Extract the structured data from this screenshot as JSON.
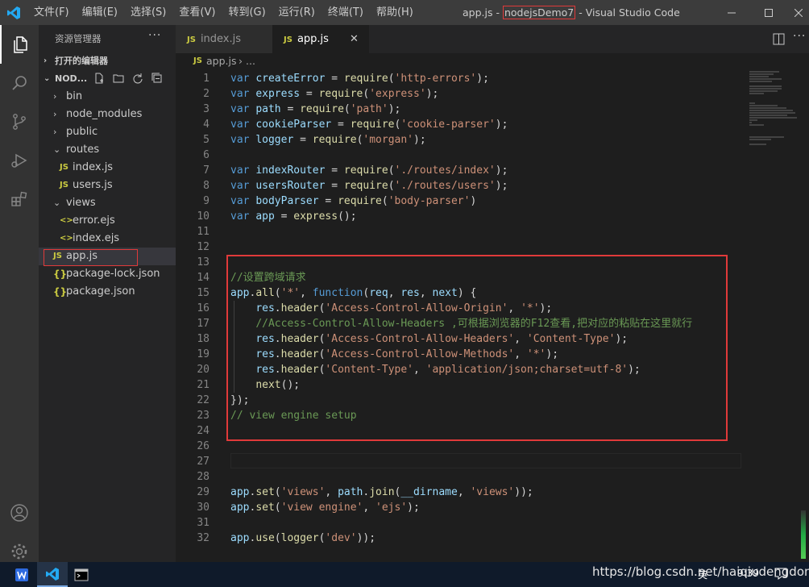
{
  "window": {
    "title_prefix": "app.js - ",
    "title_project": "nodejsDemo7",
    "title_suffix": " - Visual Studio Code"
  },
  "menu": [
    "文件(F)",
    "编辑(E)",
    "选择(S)",
    "查看(V)",
    "转到(G)",
    "运行(R)",
    "终端(T)",
    "帮助(H)"
  ],
  "sidebar": {
    "title": "资源管理器",
    "open_editors": "打开的编辑器",
    "project_label": "NOD...",
    "tree": [
      {
        "name": "bin",
        "type": "folder",
        "expanded": false,
        "depth": 0
      },
      {
        "name": "node_modules",
        "type": "folder",
        "expanded": false,
        "depth": 0
      },
      {
        "name": "public",
        "type": "folder",
        "expanded": false,
        "depth": 0
      },
      {
        "name": "routes",
        "type": "folder",
        "expanded": true,
        "depth": 0
      },
      {
        "name": "index.js",
        "type": "js",
        "depth": 1
      },
      {
        "name": "users.js",
        "type": "js",
        "depth": 1
      },
      {
        "name": "views",
        "type": "folder",
        "expanded": true,
        "depth": 0
      },
      {
        "name": "error.ejs",
        "type": "ejs",
        "depth": 1
      },
      {
        "name": "index.ejs",
        "type": "ejs",
        "depth": 1
      },
      {
        "name": "app.js",
        "type": "js",
        "depth": 0,
        "selected": true
      },
      {
        "name": "package-lock.json",
        "type": "json",
        "depth": 0
      },
      {
        "name": "package.json",
        "type": "json",
        "depth": 0
      }
    ]
  },
  "icons": {
    "js": "JS",
    "json": "{}",
    "ejs": "<>",
    "chevron_right": "›",
    "chevron_down": "⌄",
    "more": "···",
    "close": "✕"
  },
  "tabs": [
    {
      "label": "index.js",
      "active": false
    },
    {
      "label": "app.js",
      "active": true
    }
  ],
  "breadcrumb": {
    "file": "app.js",
    "rest": "..."
  },
  "code": [
    {
      "n": "1",
      "t": [
        [
          "k",
          "var "
        ],
        [
          "v",
          "createError"
        ],
        [
          "p",
          " = "
        ],
        [
          "f",
          "require"
        ],
        [
          "p",
          "("
        ],
        [
          "s",
          "'http-errors'"
        ],
        [
          "p",
          ");"
        ]
      ]
    },
    {
      "n": "2",
      "t": [
        [
          "k",
          "var "
        ],
        [
          "v",
          "express"
        ],
        [
          "p",
          " = "
        ],
        [
          "f",
          "require"
        ],
        [
          "p",
          "("
        ],
        [
          "s",
          "'express'"
        ],
        [
          "p",
          ");"
        ]
      ]
    },
    {
      "n": "3",
      "t": [
        [
          "k",
          "var "
        ],
        [
          "v",
          "path"
        ],
        [
          "p",
          " = "
        ],
        [
          "f",
          "require"
        ],
        [
          "p",
          "("
        ],
        [
          "s",
          "'path'"
        ],
        [
          "p",
          ");"
        ]
      ]
    },
    {
      "n": "4",
      "t": [
        [
          "k",
          "var "
        ],
        [
          "v",
          "cookieParser"
        ],
        [
          "p",
          " = "
        ],
        [
          "f",
          "require"
        ],
        [
          "p",
          "("
        ],
        [
          "s",
          "'cookie-parser'"
        ],
        [
          "p",
          ");"
        ]
      ]
    },
    {
      "n": "5",
      "t": [
        [
          "k",
          "var "
        ],
        [
          "v",
          "logger"
        ],
        [
          "p",
          " = "
        ],
        [
          "f",
          "require"
        ],
        [
          "p",
          "("
        ],
        [
          "s",
          "'morgan'"
        ],
        [
          "p",
          ");"
        ]
      ]
    },
    {
      "n": "6",
      "t": []
    },
    {
      "n": "7",
      "t": [
        [
          "k",
          "var "
        ],
        [
          "v",
          "indexRouter"
        ],
        [
          "p",
          " = "
        ],
        [
          "f",
          "require"
        ],
        [
          "p",
          "("
        ],
        [
          "s",
          "'./routes/index'"
        ],
        [
          "p",
          ");"
        ]
      ]
    },
    {
      "n": "8",
      "t": [
        [
          "k",
          "var "
        ],
        [
          "v",
          "usersRouter"
        ],
        [
          "p",
          " = "
        ],
        [
          "f",
          "require"
        ],
        [
          "p",
          "("
        ],
        [
          "s",
          "'./routes/users'"
        ],
        [
          "p",
          ");"
        ]
      ]
    },
    {
      "n": "9",
      "t": [
        [
          "k",
          "var "
        ],
        [
          "v",
          "bodyParser"
        ],
        [
          "p",
          " = "
        ],
        [
          "f",
          "require"
        ],
        [
          "p",
          "("
        ],
        [
          "s",
          "'body-parser'"
        ],
        [
          "p",
          ")"
        ]
      ]
    },
    {
      "n": "10",
      "t": [
        [
          "k",
          "var "
        ],
        [
          "v",
          "app"
        ],
        [
          "p",
          " = "
        ],
        [
          "f",
          "express"
        ],
        [
          "p",
          "();"
        ]
      ]
    },
    {
      "n": "11",
      "t": []
    },
    {
      "n": "12",
      "t": []
    },
    {
      "n": "13",
      "t": []
    },
    {
      "n": "14",
      "t": [
        [
          "c",
          "//设置跨域请求"
        ]
      ]
    },
    {
      "n": "15",
      "t": [
        [
          "v",
          "app"
        ],
        [
          "p",
          "."
        ],
        [
          "f",
          "all"
        ],
        [
          "p",
          "("
        ],
        [
          "s",
          "'*'"
        ],
        [
          "p",
          ", "
        ],
        [
          "k",
          "function"
        ],
        [
          "p",
          "("
        ],
        [
          "v",
          "req"
        ],
        [
          "p",
          ", "
        ],
        [
          "v",
          "res"
        ],
        [
          "p",
          ", "
        ],
        [
          "v",
          "next"
        ],
        [
          "p",
          ") {"
        ]
      ]
    },
    {
      "n": "16",
      "t": [
        [
          "p",
          "    "
        ],
        [
          "v",
          "res"
        ],
        [
          "p",
          "."
        ],
        [
          "f",
          "header"
        ],
        [
          "p",
          "("
        ],
        [
          "s",
          "'Access-Control-Allow-Origin'"
        ],
        [
          "p",
          ", "
        ],
        [
          "s",
          "'*'"
        ],
        [
          "p",
          ");"
        ]
      ]
    },
    {
      "n": "17",
      "t": [
        [
          "p",
          "    "
        ],
        [
          "c",
          "//Access-Control-Allow-Headers ,可根据浏览器的F12查看,把对应的粘贴在这里就行"
        ]
      ]
    },
    {
      "n": "18",
      "t": [
        [
          "p",
          "    "
        ],
        [
          "v",
          "res"
        ],
        [
          "p",
          "."
        ],
        [
          "f",
          "header"
        ],
        [
          "p",
          "("
        ],
        [
          "s",
          "'Access-Control-Allow-Headers'"
        ],
        [
          "p",
          ", "
        ],
        [
          "s",
          "'Content-Type'"
        ],
        [
          "p",
          ");"
        ]
      ]
    },
    {
      "n": "19",
      "t": [
        [
          "p",
          "    "
        ],
        [
          "v",
          "res"
        ],
        [
          "p",
          "."
        ],
        [
          "f",
          "header"
        ],
        [
          "p",
          "("
        ],
        [
          "s",
          "'Access-Control-Allow-Methods'"
        ],
        [
          "p",
          ", "
        ],
        [
          "s",
          "'*'"
        ],
        [
          "p",
          ");"
        ]
      ]
    },
    {
      "n": "20",
      "t": [
        [
          "p",
          "    "
        ],
        [
          "v",
          "res"
        ],
        [
          "p",
          "."
        ],
        [
          "f",
          "header"
        ],
        [
          "p",
          "("
        ],
        [
          "s",
          "'Content-Type'"
        ],
        [
          "p",
          ", "
        ],
        [
          "s",
          "'application/json;charset=utf-8'"
        ],
        [
          "p",
          ");"
        ]
      ]
    },
    {
      "n": "21",
      "t": [
        [
          "p",
          "    "
        ],
        [
          "f",
          "next"
        ],
        [
          "p",
          "();"
        ]
      ]
    },
    {
      "n": "22",
      "t": [
        [
          "p",
          "});"
        ]
      ]
    },
    {
      "n": "23",
      "t": [
        [
          "c",
          "// view engine setup"
        ]
      ]
    },
    {
      "n": "24",
      "t": []
    },
    {
      "n": "26",
      "t": []
    },
    {
      "n": "27",
      "t": []
    },
    {
      "n": "28",
      "t": []
    },
    {
      "n": "29",
      "t": [
        [
          "v",
          "app"
        ],
        [
          "p",
          "."
        ],
        [
          "f",
          "set"
        ],
        [
          "p",
          "("
        ],
        [
          "s",
          "'views'"
        ],
        [
          "p",
          ", "
        ],
        [
          "v",
          "path"
        ],
        [
          "p",
          "."
        ],
        [
          "f",
          "join"
        ],
        [
          "p",
          "("
        ],
        [
          "v",
          "__dirname"
        ],
        [
          "p",
          ", "
        ],
        [
          "s",
          "'views'"
        ],
        [
          "p",
          "));"
        ]
      ]
    },
    {
      "n": "30",
      "t": [
        [
          "v",
          "app"
        ],
        [
          "p",
          "."
        ],
        [
          "f",
          "set"
        ],
        [
          "p",
          "("
        ],
        [
          "s",
          "'view engine'"
        ],
        [
          "p",
          ", "
        ],
        [
          "s",
          "'ejs'"
        ],
        [
          "p",
          ");"
        ]
      ]
    },
    {
      "n": "31",
      "t": []
    },
    {
      "n": "32",
      "t": [
        [
          "v",
          "app"
        ],
        [
          "p",
          "."
        ],
        [
          "f",
          "use"
        ],
        [
          "p",
          "("
        ],
        [
          "f",
          "logger"
        ],
        [
          "p",
          "("
        ],
        [
          "s",
          "'dev'"
        ],
        [
          "p",
          "));"
        ]
      ]
    }
  ],
  "taskbar": {
    "tray_lang": "英",
    "tray_time": "9:39"
  },
  "watermark": "https://blog.csdn.net/haiqiudengdong",
  "colors": {
    "highlight_border": "#e03a3a",
    "activity_bar": "#333333",
    "sidebar": "#252526",
    "editor": "#1e1e1e"
  }
}
